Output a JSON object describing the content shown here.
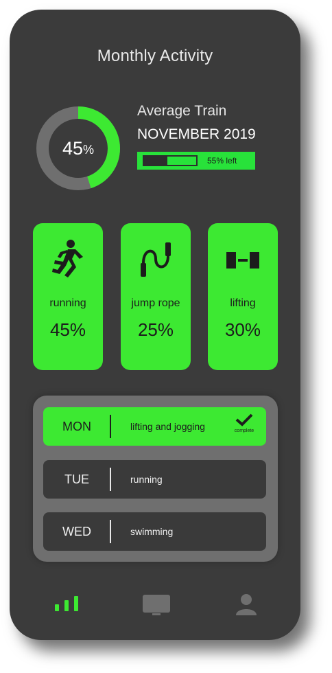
{
  "header": {
    "title": "Monthly Activity"
  },
  "summary": {
    "percent_num": "45",
    "percent_sign": "%",
    "ring_fraction": 0.45,
    "avg_title": "Average Train",
    "month": "NOVEMBER 2019",
    "progress_label": "55% left",
    "progress_fill_fraction": 0.45
  },
  "activities": [
    {
      "name": "running",
      "percent": "45%",
      "icon": "runner-icon"
    },
    {
      "name": "jump rope",
      "percent": "25%",
      "icon": "jump-rope-icon"
    },
    {
      "name": "lifting",
      "percent": "30%",
      "icon": "dumbbell-icon"
    }
  ],
  "schedule": [
    {
      "day": "MON",
      "activity": "lifting and jogging",
      "status": "complete"
    },
    {
      "day": "TUE",
      "activity": "running"
    },
    {
      "day": "WED",
      "activity": "swimming"
    }
  ],
  "nav": {
    "items": [
      "stats-icon",
      "monitor-icon",
      "profile-icon"
    ]
  },
  "colors": {
    "accent": "#3de932",
    "background": "#3b3b3b",
    "card_panel": "#6f6f6f"
  }
}
